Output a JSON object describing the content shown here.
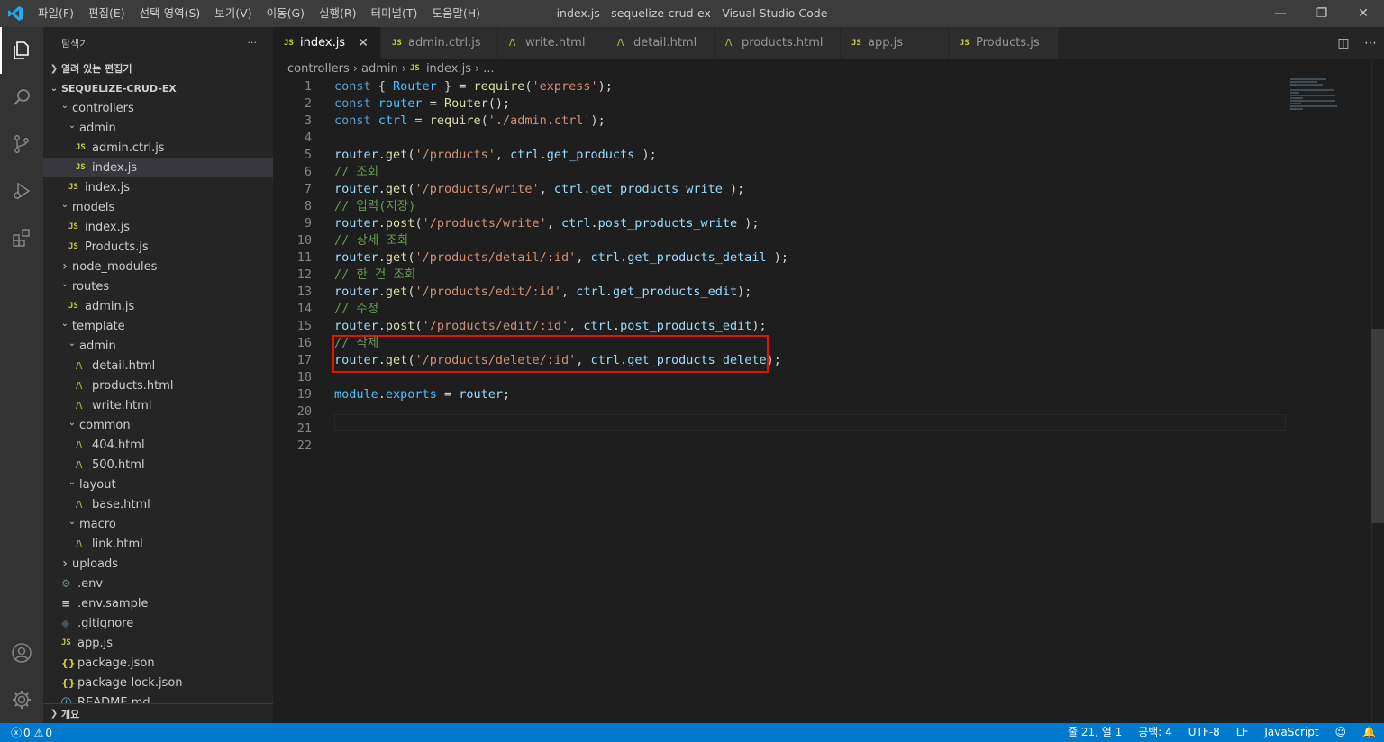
{
  "window": {
    "title": "index.js - sequelize-crud-ex - Visual Studio Code",
    "menu": [
      "파일(F)",
      "편집(E)",
      "선택 영역(S)",
      "보기(V)",
      "이동(G)",
      "실행(R)",
      "터미널(T)",
      "도움말(H)"
    ]
  },
  "sidebar": {
    "header": "탐색기",
    "more": "···",
    "open_editors": "열려 있는 편집기",
    "project": "SEQUELIZE-CRUD-EX",
    "tree": [
      {
        "label": "controllers",
        "type": "folder-open",
        "depth": 1
      },
      {
        "label": "admin",
        "type": "folder-open",
        "depth": 2
      },
      {
        "label": "admin.ctrl.js",
        "type": "js",
        "depth": 3
      },
      {
        "label": "index.js",
        "type": "js",
        "depth": 3,
        "selected": true
      },
      {
        "label": "index.js",
        "type": "js",
        "depth": 2
      },
      {
        "label": "models",
        "type": "folder-open",
        "depth": 1
      },
      {
        "label": "index.js",
        "type": "js",
        "depth": 2
      },
      {
        "label": "Products.js",
        "type": "js",
        "depth": 2
      },
      {
        "label": "node_modules",
        "type": "folder-closed",
        "depth": 1
      },
      {
        "label": "routes",
        "type": "folder-open",
        "depth": 1
      },
      {
        "label": "admin.js",
        "type": "js",
        "depth": 2
      },
      {
        "label": "template",
        "type": "folder-open",
        "depth": 1
      },
      {
        "label": "admin",
        "type": "folder-open",
        "depth": 2
      },
      {
        "label": "detail.html",
        "type": "html",
        "depth": 3
      },
      {
        "label": "products.html",
        "type": "html",
        "depth": 3
      },
      {
        "label": "write.html",
        "type": "html",
        "depth": 3
      },
      {
        "label": "common",
        "type": "folder-open",
        "depth": 2
      },
      {
        "label": "404.html",
        "type": "html",
        "depth": 3
      },
      {
        "label": "500.html",
        "type": "html",
        "depth": 3
      },
      {
        "label": "layout",
        "type": "folder-open",
        "depth": 2
      },
      {
        "label": "base.html",
        "type": "html",
        "depth": 3
      },
      {
        "label": "macro",
        "type": "folder-open",
        "depth": 2
      },
      {
        "label": "link.html",
        "type": "html",
        "depth": 3
      },
      {
        "label": "uploads",
        "type": "folder-closed",
        "depth": 1
      },
      {
        "label": ".env",
        "type": "gear",
        "depth": 1
      },
      {
        "label": ".env.sample",
        "type": "env",
        "depth": 1
      },
      {
        "label": ".gitignore",
        "type": "git",
        "depth": 1
      },
      {
        "label": "app.js",
        "type": "js",
        "depth": 1
      },
      {
        "label": "package.json",
        "type": "json",
        "depth": 1
      },
      {
        "label": "package-lock.json",
        "type": "json",
        "depth": 1
      },
      {
        "label": "README.md",
        "type": "info",
        "depth": 1
      }
    ],
    "outline": "개요"
  },
  "tabs": [
    {
      "label": "index.js",
      "type": "js",
      "active": true
    },
    {
      "label": "admin.ctrl.js",
      "type": "js"
    },
    {
      "label": "write.html",
      "type": "html"
    },
    {
      "label": "detail.html",
      "type": "html"
    },
    {
      "label": "products.html",
      "type": "html"
    },
    {
      "label": "app.js",
      "type": "js"
    },
    {
      "label": "Products.js",
      "type": "js"
    }
  ],
  "breadcrumb": [
    "controllers",
    "admin",
    "index.js",
    "..."
  ],
  "code": [
    [
      [
        "kw",
        "const"
      ],
      [
        "p",
        " { "
      ],
      [
        "var",
        "Router"
      ],
      [
        "p",
        " } = "
      ],
      [
        "fn",
        "require"
      ],
      [
        "p",
        "("
      ],
      [
        "str",
        "'express'"
      ],
      [
        "p",
        ");"
      ]
    ],
    [
      [
        "kw",
        "const"
      ],
      [
        "p",
        " "
      ],
      [
        "var",
        "router"
      ],
      [
        "p",
        " = "
      ],
      [
        "fn",
        "Router"
      ],
      [
        "p",
        "();"
      ]
    ],
    [
      [
        "kw",
        "const"
      ],
      [
        "p",
        " "
      ],
      [
        "var",
        "ctrl"
      ],
      [
        "p",
        " = "
      ],
      [
        "fn",
        "require"
      ],
      [
        "p",
        "("
      ],
      [
        "str",
        "'./admin.ctrl'"
      ],
      [
        "p",
        ");"
      ]
    ],
    [],
    [
      [
        "ident",
        "router"
      ],
      [
        "p",
        "."
      ],
      [
        "fn",
        "get"
      ],
      [
        "p",
        "("
      ],
      [
        "str",
        "'/products'"
      ],
      [
        "p",
        ", "
      ],
      [
        "ident",
        "ctrl"
      ],
      [
        "p",
        "."
      ],
      [
        "ident",
        "get_products"
      ],
      [
        "p",
        " );"
      ]
    ],
    [
      [
        "cmt",
        "// 조회"
      ]
    ],
    [
      [
        "ident",
        "router"
      ],
      [
        "p",
        "."
      ],
      [
        "fn",
        "get"
      ],
      [
        "p",
        "("
      ],
      [
        "str",
        "'/products/write'"
      ],
      [
        "p",
        ", "
      ],
      [
        "ident",
        "ctrl"
      ],
      [
        "p",
        "."
      ],
      [
        "ident",
        "get_products_write"
      ],
      [
        "p",
        " );"
      ]
    ],
    [
      [
        "cmt",
        "// 입력(저장)"
      ]
    ],
    [
      [
        "ident",
        "router"
      ],
      [
        "p",
        "."
      ],
      [
        "fn",
        "post"
      ],
      [
        "p",
        "("
      ],
      [
        "str",
        "'/products/write'"
      ],
      [
        "p",
        ", "
      ],
      [
        "ident",
        "ctrl"
      ],
      [
        "p",
        "."
      ],
      [
        "ident",
        "post_products_write"
      ],
      [
        "p",
        " );"
      ]
    ],
    [
      [
        "cmt",
        "// 상세 조회"
      ]
    ],
    [
      [
        "ident",
        "router"
      ],
      [
        "p",
        "."
      ],
      [
        "fn",
        "get"
      ],
      [
        "p",
        "("
      ],
      [
        "str",
        "'/products/detail/:id'"
      ],
      [
        "p",
        ", "
      ],
      [
        "ident",
        "ctrl"
      ],
      [
        "p",
        "."
      ],
      [
        "ident",
        "get_products_detail"
      ],
      [
        "p",
        " );"
      ]
    ],
    [
      [
        "cmt",
        "// 한 건 조회"
      ]
    ],
    [
      [
        "ident",
        "router"
      ],
      [
        "p",
        "."
      ],
      [
        "fn",
        "get"
      ],
      [
        "p",
        "("
      ],
      [
        "str",
        "'/products/edit/:id'"
      ],
      [
        "p",
        ", "
      ],
      [
        "ident",
        "ctrl"
      ],
      [
        "p",
        "."
      ],
      [
        "ident",
        "get_products_edit"
      ],
      [
        "p",
        ");"
      ]
    ],
    [
      [
        "cmt",
        "// 수정"
      ]
    ],
    [
      [
        "ident",
        "router"
      ],
      [
        "p",
        "."
      ],
      [
        "fn",
        "post"
      ],
      [
        "p",
        "("
      ],
      [
        "str",
        "'/products/edit/:id'"
      ],
      [
        "p",
        ", "
      ],
      [
        "ident",
        "ctrl"
      ],
      [
        "p",
        "."
      ],
      [
        "ident",
        "post_products_edit"
      ],
      [
        "p",
        ");"
      ]
    ],
    [
      [
        "cmt",
        "// 삭제"
      ]
    ],
    [
      [
        "ident",
        "router"
      ],
      [
        "p",
        "."
      ],
      [
        "fn",
        "get"
      ],
      [
        "p",
        "("
      ],
      [
        "str",
        "'/products/delete/:id'"
      ],
      [
        "p",
        ", "
      ],
      [
        "ident",
        "ctrl"
      ],
      [
        "p",
        "."
      ],
      [
        "ident",
        "get_products_delete"
      ],
      [
        "p",
        ");"
      ]
    ],
    [],
    [
      [
        "var",
        "module"
      ],
      [
        "p",
        "."
      ],
      [
        "var",
        "exports"
      ],
      [
        "p",
        " = "
      ],
      [
        "ident",
        "router"
      ],
      [
        "p",
        ";"
      ]
    ],
    [],
    [],
    []
  ],
  "status": {
    "errors": "0",
    "warnings": "0",
    "position": "줄 21, 열 1",
    "spaces": "공백: 4",
    "encoding": "UTF-8",
    "eol": "LF",
    "language": "JavaScript"
  },
  "colors": {
    "accent": "#007acc",
    "highlight": "#e51400"
  }
}
